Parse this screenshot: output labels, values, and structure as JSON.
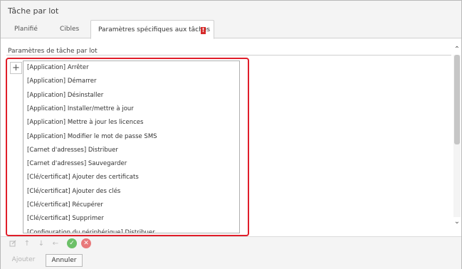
{
  "window": {
    "title": "Tâche par lot"
  },
  "tabs": [
    {
      "label": "Planifié"
    },
    {
      "label": "Cibles"
    },
    {
      "label": "Paramètres spécifiques aux tâches",
      "badge": "!"
    }
  ],
  "section": {
    "label": "Paramètres de tâche par lot"
  },
  "add_button": {
    "label": "+"
  },
  "tasks": [
    "[Application] Arrêter",
    "[Application] Démarrer",
    "[Application] Désinstaller",
    "[Application] Installer/mettre à jour",
    "[Application] Mettre à jour les licences",
    "[Application] Modifier le mot de passe SMS",
    "[Carnet d'adresses] Distribuer",
    "[Carnet d'adresses] Sauvegarder",
    "[Clé/certificat] Ajouter des certificats",
    "[Clé/certificat] Ajouter des clés",
    "[Clé/certificat] Récupérer",
    "[Clé/certificat] Supprimer",
    "[Configuration du périphérique] Distribuer"
  ],
  "toolbar": {
    "icons": [
      "edit-icon",
      "arrow-up-icon",
      "arrow-down-icon",
      "arrow-left-icon",
      "check-circle-icon",
      "close-circle-icon"
    ]
  },
  "footer": {
    "add_label": "Ajouter",
    "cancel_label": "Annuler"
  },
  "colors": {
    "highlight": "#e01e2a",
    "badge": "#d62b2b",
    "check": "#6cc068",
    "close": "#e8787a"
  }
}
